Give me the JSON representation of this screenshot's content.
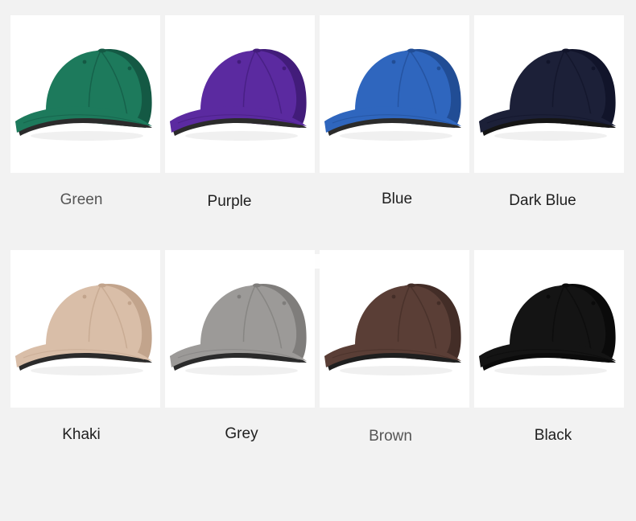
{
  "products": [
    {
      "label": "Green",
      "icon": "cap-icon",
      "color": "#1d7a5c",
      "shade": "#145944",
      "underbrim": "#2b2b2b"
    },
    {
      "label": "Purple",
      "icon": "cap-icon",
      "color": "#5b2aa0",
      "shade": "#421c7a",
      "underbrim": "#2b2b2b"
    },
    {
      "label": "Blue",
      "icon": "cap-icon",
      "color": "#2f66be",
      "shade": "#214d95",
      "underbrim": "#2b2b2b"
    },
    {
      "label": "Dark Blue",
      "icon": "cap-icon",
      "color": "#1c2038",
      "shade": "#11142a",
      "underbrim": "#151515"
    },
    {
      "label": "Khaki",
      "icon": "cap-icon",
      "color": "#d9bea8",
      "shade": "#c2a48c",
      "underbrim": "#2b2b2b"
    },
    {
      "label": "Grey",
      "icon": "cap-icon",
      "color": "#9c9a98",
      "shade": "#7f7d7b",
      "underbrim": "#2b2b2b"
    },
    {
      "label": "Brown",
      "icon": "cap-icon",
      "color": "#5a3e36",
      "shade": "#432d27",
      "underbrim": "#1f1f1f"
    },
    {
      "label": "Black",
      "icon": "cap-icon",
      "color": "#141414",
      "shade": "#0a0a0a",
      "underbrim": "#0b0b0b"
    }
  ]
}
